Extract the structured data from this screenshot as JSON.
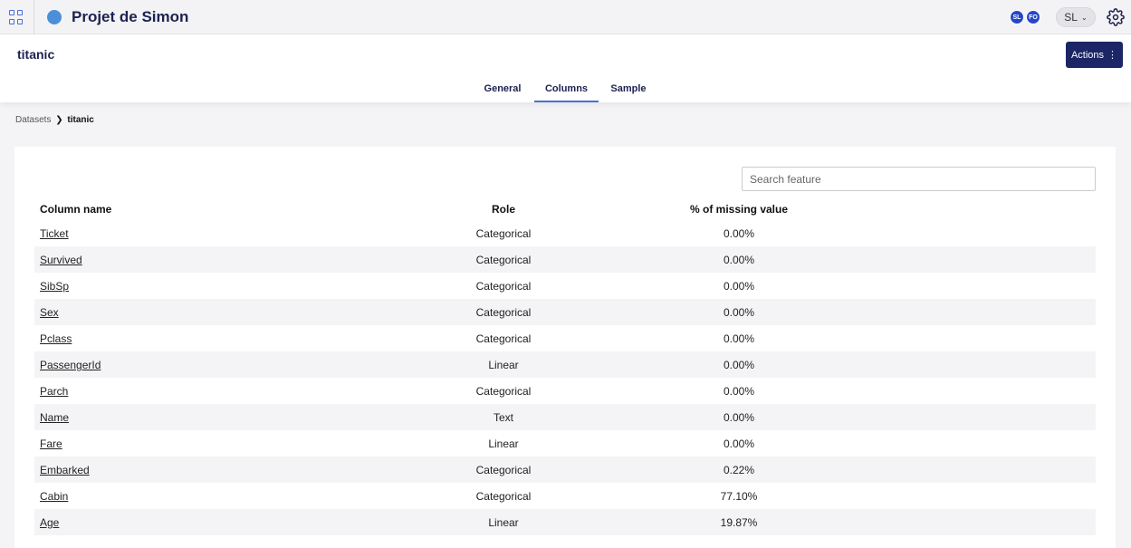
{
  "topbar": {
    "project_name": "Projet de Simon",
    "avatars": [
      "SL",
      "FO"
    ],
    "user_label": "SL",
    "user_caret": "⌄"
  },
  "header": {
    "dataset_title": "titanic",
    "actions_label": "Actions",
    "actions_icon": "⋮"
  },
  "tabs": [
    {
      "label": "General",
      "active": false
    },
    {
      "label": "Columns",
      "active": true
    },
    {
      "label": "Sample",
      "active": false
    }
  ],
  "breadcrumb": {
    "root": "Datasets",
    "separator": "❯",
    "current": "titanic"
  },
  "search": {
    "placeholder": "Search feature",
    "value": ""
  },
  "table": {
    "headers": {
      "name": "Column name",
      "role": "Role",
      "missing": "% of missing value"
    },
    "rows": [
      {
        "name": "Ticket",
        "role": "Categorical",
        "missing": "0.00%"
      },
      {
        "name": "Survived",
        "role": "Categorical",
        "missing": "0.00%"
      },
      {
        "name": "SibSp",
        "role": "Categorical",
        "missing": "0.00%"
      },
      {
        "name": "Sex",
        "role": "Categorical",
        "missing": "0.00%"
      },
      {
        "name": "Pclass",
        "role": "Categorical",
        "missing": "0.00%"
      },
      {
        "name": "PassengerId",
        "role": "Linear",
        "missing": "0.00%"
      },
      {
        "name": "Parch",
        "role": "Categorical",
        "missing": "0.00%"
      },
      {
        "name": "Name",
        "role": "Text",
        "missing": "0.00%"
      },
      {
        "name": "Fare",
        "role": "Linear",
        "missing": "0.00%"
      },
      {
        "name": "Embarked",
        "role": "Categorical",
        "missing": "0.22%"
      },
      {
        "name": "Cabin",
        "role": "Categorical",
        "missing": "77.10%"
      },
      {
        "name": "Age",
        "role": "Linear",
        "missing": "19.87%"
      }
    ]
  },
  "colors": {
    "accent": "#4a6fd6",
    "primary_button": "#1c2565",
    "avatar": "#2746c9",
    "project_dot": "#4a90d9"
  },
  "icons": {
    "apps": "apps-grid-icon",
    "settings": "gear-icon"
  }
}
